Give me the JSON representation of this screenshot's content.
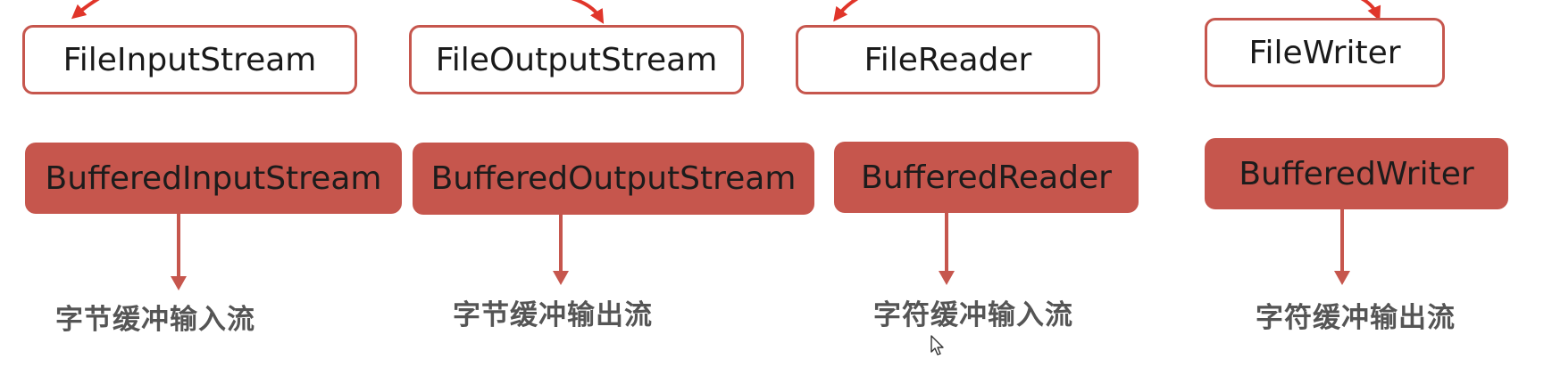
{
  "colors": {
    "accent_red": "#c6564d",
    "arrow_red": "#c6564d",
    "top_arrow_red": "#e0352a",
    "caption_gray": "#555555"
  },
  "columns": [
    {
      "base": "FileInputStream",
      "buffered": "BufferedInputStream",
      "caption": "字节缓冲输入流"
    },
    {
      "base": "FileOutputStream",
      "buffered": "BufferedOutputStream",
      "caption": "字节缓冲输出流"
    },
    {
      "base": "FileReader",
      "buffered": "BufferedReader",
      "caption": "字符缓冲输入流"
    },
    {
      "base": "FileWriter",
      "buffered": "BufferedWriter",
      "caption": "字符缓冲输出流"
    }
  ],
  "icons": {
    "cursor": "mouse-pointer-icon"
  }
}
